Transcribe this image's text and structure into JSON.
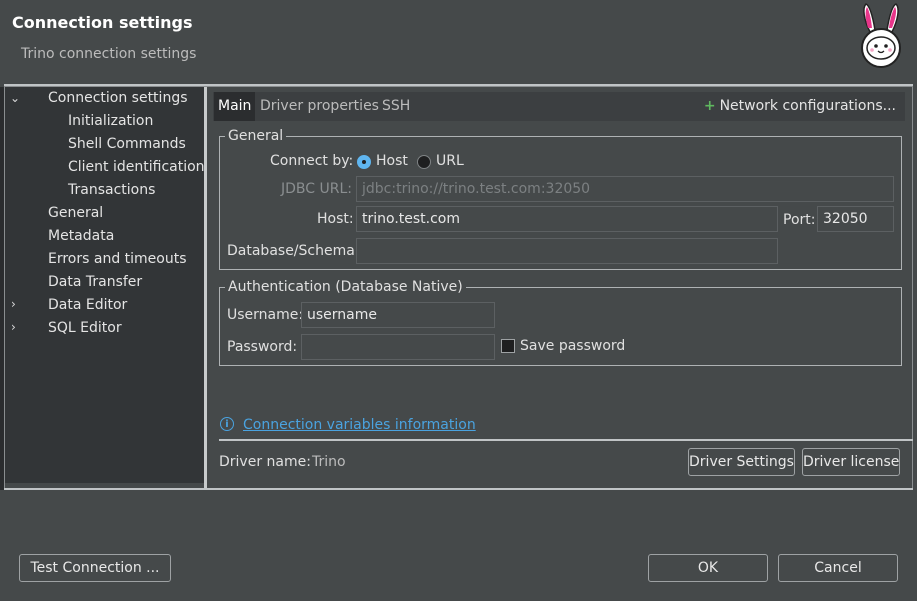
{
  "dialog": {
    "title": "Connection settings",
    "subtitle": "Trino connection settings",
    "mascot_icon": "bunny-astronaut-icon"
  },
  "tree": {
    "items": [
      {
        "label": "Connection settings",
        "level": 0,
        "arrow": "chevron-down-icon",
        "selected": true
      },
      {
        "label": "Initialization",
        "level": 1
      },
      {
        "label": "Shell Commands",
        "level": 1
      },
      {
        "label": "Client identification",
        "level": 1
      },
      {
        "label": "Transactions",
        "level": 1
      },
      {
        "label": "General",
        "level": 0
      },
      {
        "label": "Metadata",
        "level": 0
      },
      {
        "label": "Errors and timeouts",
        "level": 0
      },
      {
        "label": "Data Transfer",
        "level": 0
      },
      {
        "label": "Data Editor",
        "level": 0,
        "arrow": "chevron-right-icon"
      },
      {
        "label": "SQL Editor",
        "level": 0,
        "arrow": "chevron-right-icon"
      }
    ]
  },
  "tabs": {
    "items": [
      {
        "label": "Main",
        "active": true
      },
      {
        "label": "Driver properties"
      },
      {
        "label": "SSH"
      }
    ],
    "network_configurations": "Network configurations..."
  },
  "general": {
    "legend": "General",
    "connect_by_label": "Connect by:",
    "connect_by_options": [
      {
        "label": "Host",
        "selected": true
      },
      {
        "label": "URL",
        "selected": false
      }
    ],
    "jdbc_url_label": "JDBC URL:",
    "jdbc_url_value": "jdbc:trino://trino.test.com:32050",
    "host_label": "Host:",
    "host_value": "trino.test.com",
    "port_label": "Port:",
    "port_value": "32050",
    "database_label": "Database/Schema:",
    "database_value": ""
  },
  "auth": {
    "legend": "Authentication (Database Native)",
    "username_label": "Username:",
    "username_value": "username",
    "password_label": "Password:",
    "password_value": "",
    "save_password_label": "Save password",
    "save_password_checked": false
  },
  "info": {
    "icon": "info-icon",
    "link_text": "Connection variables information"
  },
  "driver": {
    "name_label": "Driver name:",
    "name_value": "Trino",
    "settings_button": "Driver Settings",
    "license_button": "Driver license"
  },
  "footer": {
    "test_connection": "Test Connection ...",
    "ok": "OK",
    "cancel": "Cancel"
  },
  "colors": {
    "accent": "#4aa3e0",
    "radio_selected": "#5fb5ef",
    "plus_icon": "#5fb85f"
  }
}
